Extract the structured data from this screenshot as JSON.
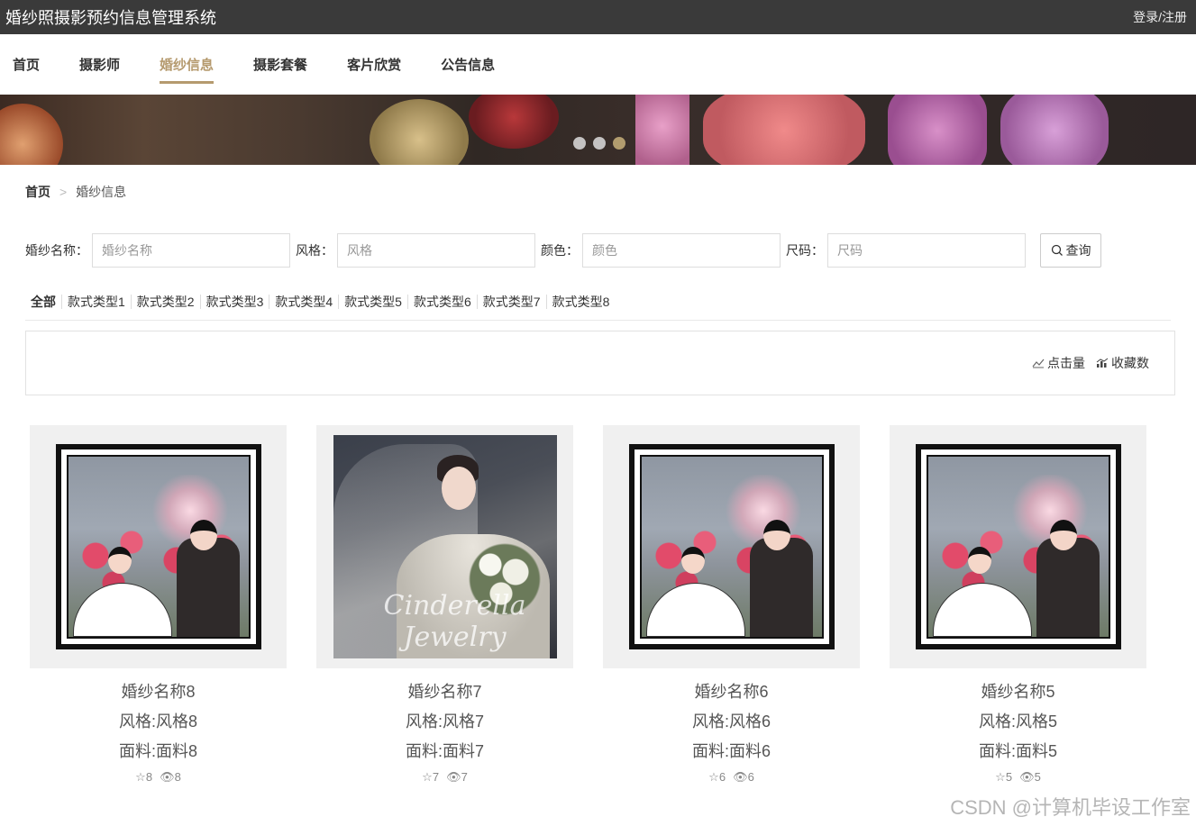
{
  "header": {
    "title": "婚纱照摄影预约信息管理系统",
    "login_label": "登录/注册"
  },
  "nav": {
    "items": [
      {
        "label": "首页"
      },
      {
        "label": "摄影师"
      },
      {
        "label": "婚纱信息"
      },
      {
        "label": "摄影套餐"
      },
      {
        "label": "客片欣赏"
      },
      {
        "label": "公告信息"
      }
    ],
    "active_index": 2
  },
  "banner": {
    "slide_count": 3,
    "active_slide": 3
  },
  "breadcrumb": {
    "home": "首页",
    "separator": ">",
    "current": "婚纱信息"
  },
  "search": {
    "fields": [
      {
        "label": "婚纱名称：",
        "placeholder": "婚纱名称"
      },
      {
        "label": "风格：",
        "placeholder": "风格"
      },
      {
        "label": "颜色：",
        "placeholder": "颜色"
      },
      {
        "label": "尺码：",
        "placeholder": "尺码"
      }
    ],
    "button_label": "查询"
  },
  "categories": [
    "全部",
    "款式类型1",
    "款式类型2",
    "款式类型3",
    "款式类型4",
    "款式类型5",
    "款式类型6",
    "款式类型7",
    "款式类型8"
  ],
  "sort": {
    "clicks_label": "点击量",
    "favorites_label": "收藏数"
  },
  "cards": [
    {
      "name": "婚纱名称8",
      "style": "风格:风格8",
      "fabric": "面料:面料8",
      "favorites": "8",
      "views": "8",
      "image": "couple-illustration"
    },
    {
      "name": "婚纱名称7",
      "style": "风格:风格7",
      "fabric": "面料:面料7",
      "favorites": "7",
      "views": "7",
      "image": "bride-photo"
    },
    {
      "name": "婚纱名称6",
      "style": "风格:风格6",
      "fabric": "面料:面料6",
      "favorites": "6",
      "views": "6",
      "image": "couple-illustration"
    },
    {
      "name": "婚纱名称5",
      "style": "风格:风格5",
      "fabric": "面料:面料5",
      "favorites": "5",
      "views": "5",
      "image": "couple-illustration"
    }
  ],
  "photo_signature": "Cinderella Jewelry",
  "watermark": "CSDN @计算机毕设工作室",
  "colors": {
    "topbar": "#3a3a3a",
    "accent": "#b59a6e"
  }
}
